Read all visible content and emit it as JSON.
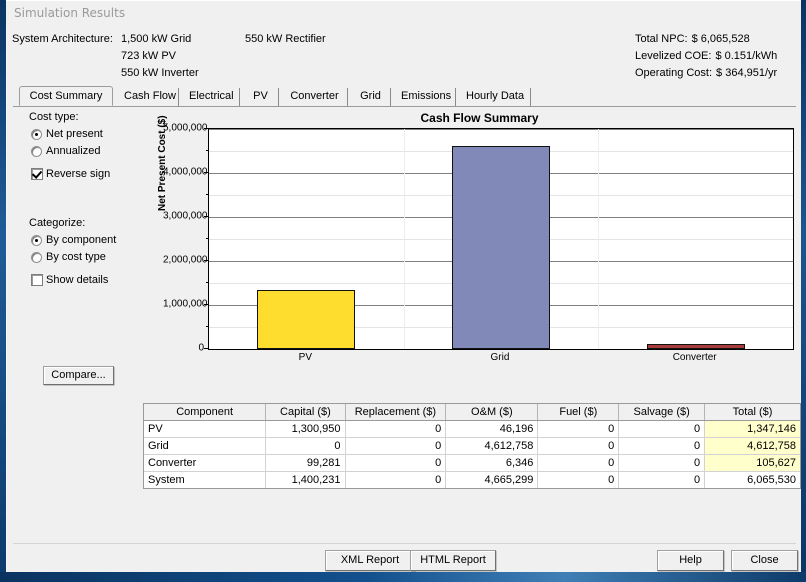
{
  "window": {
    "title": "Simulation Results"
  },
  "architecture": {
    "label": "System Architecture:",
    "col1": [
      "1,500 kW Grid",
      "723 kW PV",
      "550 kW Inverter"
    ],
    "col2": "550 kW Rectifier"
  },
  "summary": [
    {
      "key": "Total NPC:",
      "value": "$ 6,065,528"
    },
    {
      "key": "Levelized COE:",
      "value": "$ 0.151/kWh"
    },
    {
      "key": "Operating Cost:",
      "value": "$ 364,951/yr"
    }
  ],
  "tabs": [
    {
      "label": "Cost Summary",
      "active": true
    },
    {
      "label": "Cash Flow",
      "active": false
    },
    {
      "label": "Electrical",
      "active": false
    },
    {
      "label": "PV",
      "active": false
    },
    {
      "label": "Converter",
      "active": false
    },
    {
      "label": "Grid",
      "active": false
    },
    {
      "label": "Emissions",
      "active": false
    },
    {
      "label": "Hourly Data",
      "active": false
    }
  ],
  "options": {
    "cost_type_label": "Cost type:",
    "cost_type": [
      {
        "label": "Net present",
        "selected": true
      },
      {
        "label": "Annualized",
        "selected": false
      }
    ],
    "reverse_sign": {
      "label": "Reverse sign",
      "checked": true
    },
    "categorize_label": "Categorize:",
    "categorize": [
      {
        "label": "By component",
        "selected": true
      },
      {
        "label": "By cost type",
        "selected": false
      }
    ],
    "show_details": {
      "label": "Show details",
      "checked": false
    },
    "compare_label": "Compare..."
  },
  "chart_data": {
    "type": "bar",
    "title": "Cash Flow Summary",
    "xlabel": "",
    "ylabel": "Net Present Cost ($)",
    "categories": [
      "PV",
      "Grid",
      "Converter"
    ],
    "values": [
      1347146,
      4612758,
      105627
    ],
    "colors": [
      "#ffdd2f",
      "#8189b8",
      "#a83c3c"
    ],
    "ylim": [
      0,
      5000000
    ],
    "ytick_labels": [
      "0",
      "1,000,000",
      "2,000,000",
      "3,000,000",
      "4,000,000",
      "5,000,000"
    ],
    "ytick_values": [
      0,
      1000000,
      2000000,
      3000000,
      4000000,
      5000000
    ],
    "minor_tick_step": 500000,
    "grid": true,
    "legend": "none"
  },
  "table": {
    "headers": [
      "Component",
      "Capital ($)",
      "Replacement ($)",
      "O&M ($)",
      "Fuel ($)",
      "Salvage ($)",
      "Total ($)"
    ],
    "rows": [
      {
        "cells": [
          "PV",
          "1,300,950",
          "0",
          "46,196",
          "0",
          "0",
          "1,347,146"
        ],
        "highlight_total": true
      },
      {
        "cells": [
          "Grid",
          "0",
          "0",
          "4,612,758",
          "0",
          "0",
          "4,612,758"
        ],
        "highlight_total": true
      },
      {
        "cells": [
          "Converter",
          "99,281",
          "0",
          "6,346",
          "0",
          "0",
          "105,627"
        ],
        "highlight_total": true
      },
      {
        "cells": [
          "System",
          "1,400,231",
          "0",
          "4,665,299",
          "0",
          "0",
          "6,065,530"
        ],
        "highlight_total": false
      }
    ]
  },
  "buttons": {
    "xml_report": "XML Report",
    "html_report": "HTML Report",
    "help": "Help",
    "close": "Close"
  },
  "colors": {
    "window_border": "#0d3c6e",
    "panel": "#f0f0f0",
    "total_highlight": "#ffffcc"
  }
}
